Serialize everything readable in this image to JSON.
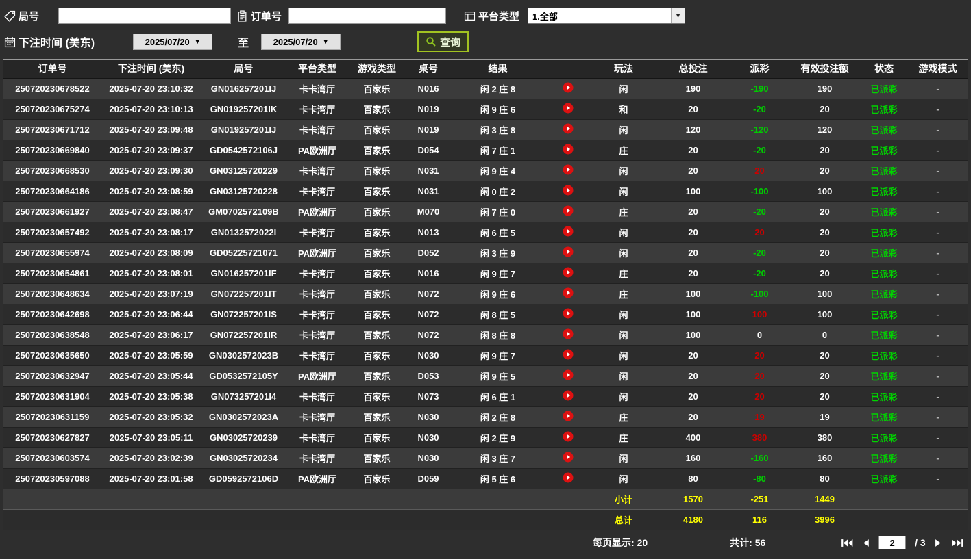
{
  "colors": {
    "win": "#cc0000",
    "loss": "#00cc00",
    "paid": "#00d400",
    "summary": "#ffff00"
  },
  "filters": {
    "round_label": "局号",
    "order_label": "订单号",
    "platform_label": "平台类型",
    "platform_value": "1.全部",
    "bet_time_label": "下注时间 (美东)",
    "date_from": "2025/07/20",
    "date_to": "2025/07/20",
    "to_label": "至",
    "search_label": "查询"
  },
  "table": {
    "headers": [
      "订单号",
      "下注时间 (美东)",
      "局号",
      "平台类型",
      "游戏类型",
      "桌号",
      "结果",
      "",
      "玩法",
      "总投注",
      "派彩",
      "有效投注额",
      "状态",
      "游戏模式"
    ],
    "rows": [
      {
        "order": "250720230678522",
        "time": "2025-07-20 23:10:32",
        "round": "GN016257201IJ",
        "platform": "卡卡湾厅",
        "game": "百家乐",
        "table": "N016",
        "result": "闲 2 庄 8",
        "bet_on": "闲",
        "total_bet": "190",
        "payout": "-190",
        "payout_tone": "loss",
        "valid_bet": "190",
        "status": "已派彩",
        "mode": "-"
      },
      {
        "order": "250720230675274",
        "time": "2025-07-20 23:10:13",
        "round": "GN019257201IK",
        "platform": "卡卡湾厅",
        "game": "百家乐",
        "table": "N019",
        "result": "闲 9 庄 6",
        "bet_on": "和",
        "total_bet": "20",
        "payout": "-20",
        "payout_tone": "loss",
        "valid_bet": "20",
        "status": "已派彩",
        "mode": "-"
      },
      {
        "order": "250720230671712",
        "time": "2025-07-20 23:09:48",
        "round": "GN019257201IJ",
        "platform": "卡卡湾厅",
        "game": "百家乐",
        "table": "N019",
        "result": "闲 3 庄 8",
        "bet_on": "闲",
        "total_bet": "120",
        "payout": "-120",
        "payout_tone": "loss",
        "valid_bet": "120",
        "status": "已派彩",
        "mode": "-"
      },
      {
        "order": "250720230669840",
        "time": "2025-07-20 23:09:37",
        "round": "GD0542572106J",
        "platform": "PA欧洲厅",
        "game": "百家乐",
        "table": "D054",
        "result": "闲 7 庄 1",
        "bet_on": "庄",
        "total_bet": "20",
        "payout": "-20",
        "payout_tone": "loss",
        "valid_bet": "20",
        "status": "已派彩",
        "mode": "-"
      },
      {
        "order": "250720230668530",
        "time": "2025-07-20 23:09:30",
        "round": "GN03125720229",
        "platform": "卡卡湾厅",
        "game": "百家乐",
        "table": "N031",
        "result": "闲 9 庄 4",
        "bet_on": "闲",
        "total_bet": "20",
        "payout": "20",
        "payout_tone": "win",
        "valid_bet": "20",
        "status": "已派彩",
        "mode": "-"
      },
      {
        "order": "250720230664186",
        "time": "2025-07-20 23:08:59",
        "round": "GN03125720228",
        "platform": "卡卡湾厅",
        "game": "百家乐",
        "table": "N031",
        "result": "闲 0 庄 2",
        "bet_on": "闲",
        "total_bet": "100",
        "payout": "-100",
        "payout_tone": "loss",
        "valid_bet": "100",
        "status": "已派彩",
        "mode": "-"
      },
      {
        "order": "250720230661927",
        "time": "2025-07-20 23:08:47",
        "round": "GM0702572109B",
        "platform": "PA欧洲厅",
        "game": "百家乐",
        "table": "M070",
        "result": "闲 7 庄 0",
        "bet_on": "庄",
        "total_bet": "20",
        "payout": "-20",
        "payout_tone": "loss",
        "valid_bet": "20",
        "status": "已派彩",
        "mode": "-"
      },
      {
        "order": "250720230657492",
        "time": "2025-07-20 23:08:17",
        "round": "GN0132572022I",
        "platform": "卡卡湾厅",
        "game": "百家乐",
        "table": "N013",
        "result": "闲 6 庄 5",
        "bet_on": "闲",
        "total_bet": "20",
        "payout": "20",
        "payout_tone": "win",
        "valid_bet": "20",
        "status": "已派彩",
        "mode": "-"
      },
      {
        "order": "250720230655974",
        "time": "2025-07-20 23:08:09",
        "round": "GD05225721071",
        "platform": "PA欧洲厅",
        "game": "百家乐",
        "table": "D052",
        "result": "闲 3 庄 9",
        "bet_on": "闲",
        "total_bet": "20",
        "payout": "-20",
        "payout_tone": "loss",
        "valid_bet": "20",
        "status": "已派彩",
        "mode": "-"
      },
      {
        "order": "250720230654861",
        "time": "2025-07-20 23:08:01",
        "round": "GN016257201IF",
        "platform": "卡卡湾厅",
        "game": "百家乐",
        "table": "N016",
        "result": "闲 9 庄 7",
        "bet_on": "庄",
        "total_bet": "20",
        "payout": "-20",
        "payout_tone": "loss",
        "valid_bet": "20",
        "status": "已派彩",
        "mode": "-"
      },
      {
        "order": "250720230648634",
        "time": "2025-07-20 23:07:19",
        "round": "GN072257201IT",
        "platform": "卡卡湾厅",
        "game": "百家乐",
        "table": "N072",
        "result": "闲 9 庄 6",
        "bet_on": "庄",
        "total_bet": "100",
        "payout": "-100",
        "payout_tone": "loss",
        "valid_bet": "100",
        "status": "已派彩",
        "mode": "-"
      },
      {
        "order": "250720230642698",
        "time": "2025-07-20 23:06:44",
        "round": "GN072257201IS",
        "platform": "卡卡湾厅",
        "game": "百家乐",
        "table": "N072",
        "result": "闲 8 庄 5",
        "bet_on": "闲",
        "total_bet": "100",
        "payout": "100",
        "payout_tone": "win",
        "valid_bet": "100",
        "status": "已派彩",
        "mode": "-"
      },
      {
        "order": "250720230638548",
        "time": "2025-07-20 23:06:17",
        "round": "GN072257201IR",
        "platform": "卡卡湾厅",
        "game": "百家乐",
        "table": "N072",
        "result": "闲 8 庄 8",
        "bet_on": "闲",
        "total_bet": "100",
        "payout": "0",
        "payout_tone": "zero",
        "valid_bet": "0",
        "status": "已派彩",
        "mode": "-"
      },
      {
        "order": "250720230635650",
        "time": "2025-07-20 23:05:59",
        "round": "GN0302572023B",
        "platform": "卡卡湾厅",
        "game": "百家乐",
        "table": "N030",
        "result": "闲 9 庄 7",
        "bet_on": "闲",
        "total_bet": "20",
        "payout": "20",
        "payout_tone": "win",
        "valid_bet": "20",
        "status": "已派彩",
        "mode": "-"
      },
      {
        "order": "250720230632947",
        "time": "2025-07-20 23:05:44",
        "round": "GD0532572105Y",
        "platform": "PA欧洲厅",
        "game": "百家乐",
        "table": "D053",
        "result": "闲 9 庄 5",
        "bet_on": "闲",
        "total_bet": "20",
        "payout": "20",
        "payout_tone": "win",
        "valid_bet": "20",
        "status": "已派彩",
        "mode": "-"
      },
      {
        "order": "250720230631904",
        "time": "2025-07-20 23:05:38",
        "round": "GN073257201I4",
        "platform": "卡卡湾厅",
        "game": "百家乐",
        "table": "N073",
        "result": "闲 6 庄 1",
        "bet_on": "闲",
        "total_bet": "20",
        "payout": "20",
        "payout_tone": "win",
        "valid_bet": "20",
        "status": "已派彩",
        "mode": "-"
      },
      {
        "order": "250720230631159",
        "time": "2025-07-20 23:05:32",
        "round": "GN0302572023A",
        "platform": "卡卡湾厅",
        "game": "百家乐",
        "table": "N030",
        "result": "闲 2 庄 8",
        "bet_on": "庄",
        "total_bet": "20",
        "payout": "19",
        "payout_tone": "win",
        "valid_bet": "19",
        "status": "已派彩",
        "mode": "-"
      },
      {
        "order": "250720230627827",
        "time": "2025-07-20 23:05:11",
        "round": "GN03025720239",
        "platform": "卡卡湾厅",
        "game": "百家乐",
        "table": "N030",
        "result": "闲 2 庄 9",
        "bet_on": "庄",
        "total_bet": "400",
        "payout": "380",
        "payout_tone": "win",
        "valid_bet": "380",
        "status": "已派彩",
        "mode": "-"
      },
      {
        "order": "250720230603574",
        "time": "2025-07-20 23:02:39",
        "round": "GN03025720234",
        "platform": "卡卡湾厅",
        "game": "百家乐",
        "table": "N030",
        "result": "闲 3 庄 7",
        "bet_on": "闲",
        "total_bet": "160",
        "payout": "-160",
        "payout_tone": "loss",
        "valid_bet": "160",
        "status": "已派彩",
        "mode": "-"
      },
      {
        "order": "250720230597088",
        "time": "2025-07-20 23:01:58",
        "round": "GD0592572106D",
        "platform": "PA欧洲厅",
        "game": "百家乐",
        "table": "D059",
        "result": "闲 5 庄 6",
        "bet_on": "闲",
        "total_bet": "80",
        "payout": "-80",
        "payout_tone": "loss",
        "valid_bet": "80",
        "status": "已派彩",
        "mode": "-"
      }
    ]
  },
  "summary": {
    "subtotal_label": "小计",
    "subtotal": [
      "1570",
      "-251",
      "1449"
    ],
    "total_label": "总计",
    "total": [
      "4180",
      "116",
      "3996"
    ]
  },
  "pagination": {
    "per_page_label": "每页显示:",
    "per_page_value": "20",
    "total_count_label": "共计:",
    "total_count_value": "56",
    "current_page": "2",
    "separator": "/",
    "total_pages": "3"
  }
}
